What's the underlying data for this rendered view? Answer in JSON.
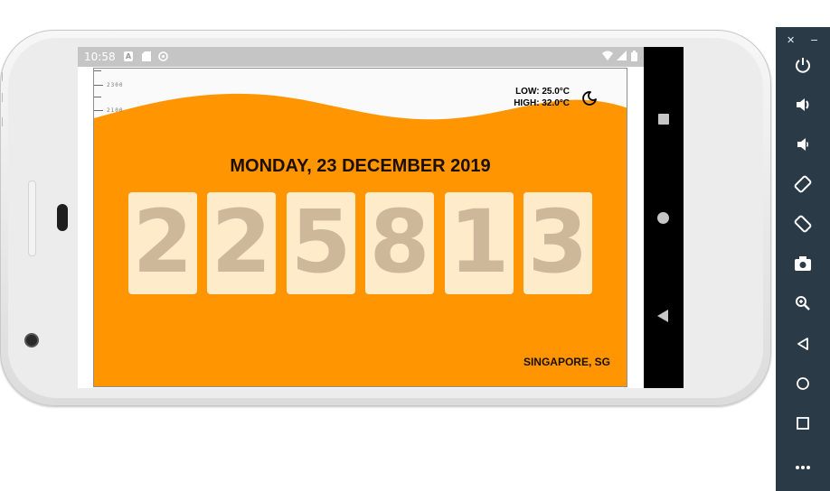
{
  "status_bar": {
    "time": "10:58",
    "icons": [
      "a-icon",
      "sd-card-icon",
      "sync-icon"
    ],
    "right_icons": [
      "wifi-icon",
      "signal-icon",
      "battery-icon"
    ]
  },
  "app": {
    "ruler_labels": [
      "2300",
      "2100"
    ],
    "weather": {
      "low": "LOW: 25.0°C",
      "high": "HIGH: 32.0°C",
      "icon": "moon-icon"
    },
    "date": "MONDAY, 23 DECEMBER 2019",
    "digits": [
      "2",
      "2",
      "5",
      "8",
      "1",
      "3"
    ],
    "location": "SINGAPORE, SG",
    "colors": {
      "background_top": "#fafafa",
      "wave": "#ff9500",
      "card": "#fdebc9",
      "digit": "#cdb99a",
      "text": "#1a0f00"
    }
  },
  "navigation": [
    "recent-apps-button",
    "home-button",
    "back-button"
  ],
  "emulator_toolbar": {
    "close": "✕",
    "minimize": "−",
    "buttons": [
      {
        "name": "power-button",
        "glyph": "⏻"
      },
      {
        "name": "volume-up-button",
        "glyph": "🔊"
      },
      {
        "name": "volume-down-button",
        "glyph": "🔉"
      },
      {
        "name": "rotate-left-button",
        "glyph": "⟲"
      },
      {
        "name": "rotate-right-button",
        "glyph": "⟳"
      },
      {
        "name": "screenshot-button",
        "glyph": "📷"
      },
      {
        "name": "zoom-button",
        "glyph": "🔍"
      },
      {
        "name": "back-button",
        "glyph": "◁"
      },
      {
        "name": "home-button",
        "glyph": "○"
      },
      {
        "name": "overview-button",
        "glyph": "□"
      },
      {
        "name": "more-button",
        "glyph": "⋯"
      }
    ]
  }
}
